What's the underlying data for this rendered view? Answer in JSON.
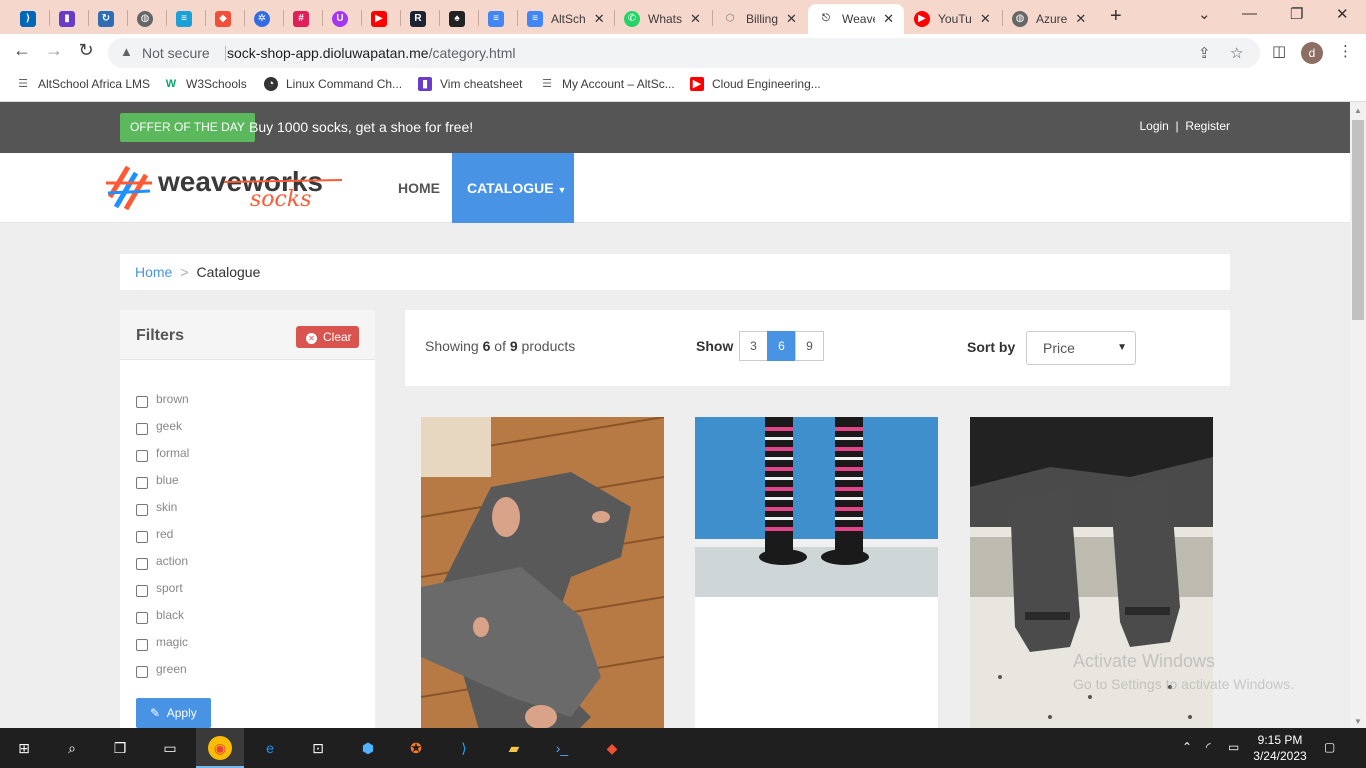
{
  "browser": {
    "tabs": [
      {
        "title": "",
        "icon": "vscode-icon",
        "color": "#0066b8"
      },
      {
        "title": "",
        "icon": "bookmark-icon",
        "color": "#6a3bc7"
      },
      {
        "title": "",
        "icon": "refresh-icon",
        "color": "#2f6db5"
      },
      {
        "title": "",
        "icon": "globe-icon",
        "color": "#666666"
      },
      {
        "title": "",
        "icon": "cisco-icon",
        "color": "#1ba0d7"
      },
      {
        "title": "",
        "icon": "laravel-icon",
        "color": "#f0503a"
      },
      {
        "title": "",
        "icon": "gear-icon",
        "color": "#326ce5"
      },
      {
        "title": "",
        "icon": "slack-icon",
        "color": "#4a154b"
      },
      {
        "title": "",
        "icon": "udemy-icon",
        "color": "#a435f0"
      },
      {
        "title": "",
        "icon": "youtube-icon",
        "color": "#ff0000"
      },
      {
        "title": "",
        "icon": "replit-icon",
        "color": "#1c2333"
      },
      {
        "title": "",
        "icon": "student-icon",
        "color": "#222222"
      },
      {
        "title": "",
        "icon": "docs-icon",
        "color": "#4285f4"
      },
      {
        "title": "AltSch",
        "icon": "docs-icon",
        "color": "#4285f4"
      },
      {
        "title": "Whats",
        "icon": "whatsapp-icon",
        "color": "#25d366"
      },
      {
        "title": "Billing",
        "icon": "aws-icon",
        "color": "#777777"
      },
      {
        "title": "Weave",
        "icon": "weaveworks-icon",
        "color": "#555555"
      },
      {
        "title": "YouTu",
        "icon": "youtube-icon",
        "color": "#ff0000"
      },
      {
        "title": "Azure",
        "icon": "globe-icon",
        "color": "#666666"
      }
    ],
    "not_secure": "Not secure",
    "url_host": "sock-shop-app.dioluwapatan.me",
    "url_path": "/category.html",
    "avatar_letter": "d",
    "bookmarks": [
      {
        "label": "AltSchool Africa LMS",
        "icon": "altschool-icon"
      },
      {
        "label": "W3Schools",
        "icon": "w3schools-icon"
      },
      {
        "label": "Linux Command Ch...",
        "icon": "linux-icon"
      },
      {
        "label": "Vim cheatsheet",
        "icon": "bookmark-icon"
      },
      {
        "label": "My Account – AltSc...",
        "icon": "altschool-icon"
      },
      {
        "label": "Cloud Engineering...",
        "icon": "youtube-icon"
      }
    ]
  },
  "site": {
    "offer_button": "OFFER OF THE DAY",
    "offer_text": "Buy 1000 socks, get a shoe for free!",
    "login": "Login",
    "separator": "|",
    "register": "Register",
    "logo_top": "weaveworks",
    "logo_bottom": "socks",
    "nav_home": "HOME",
    "nav_catalogue": "CATALOGUE",
    "breadcrumb_home": "Home",
    "breadcrumb_sep": ">",
    "breadcrumb_current": "Catalogue"
  },
  "filters": {
    "title": "Filters",
    "clear": "Clear",
    "apply": "Apply",
    "tags": [
      "brown",
      "geek",
      "formal",
      "blue",
      "skin",
      "red",
      "action",
      "sport",
      "black",
      "magic",
      "green"
    ]
  },
  "products_bar": {
    "showing_prefix": "Showing",
    "shown": "6",
    "of": "of",
    "total": "9",
    "suffix": "products",
    "show_label": "Show",
    "page_sizes": [
      "3",
      "6",
      "9"
    ],
    "active_size": "6",
    "sort_label": "Sort by",
    "sort_value": "Price"
  },
  "watermark": {
    "line1": "Activate Windows",
    "line2": "Go to Settings to activate Windows."
  },
  "taskbar": {
    "time": "9:15 PM",
    "date": "3/24/2023"
  }
}
